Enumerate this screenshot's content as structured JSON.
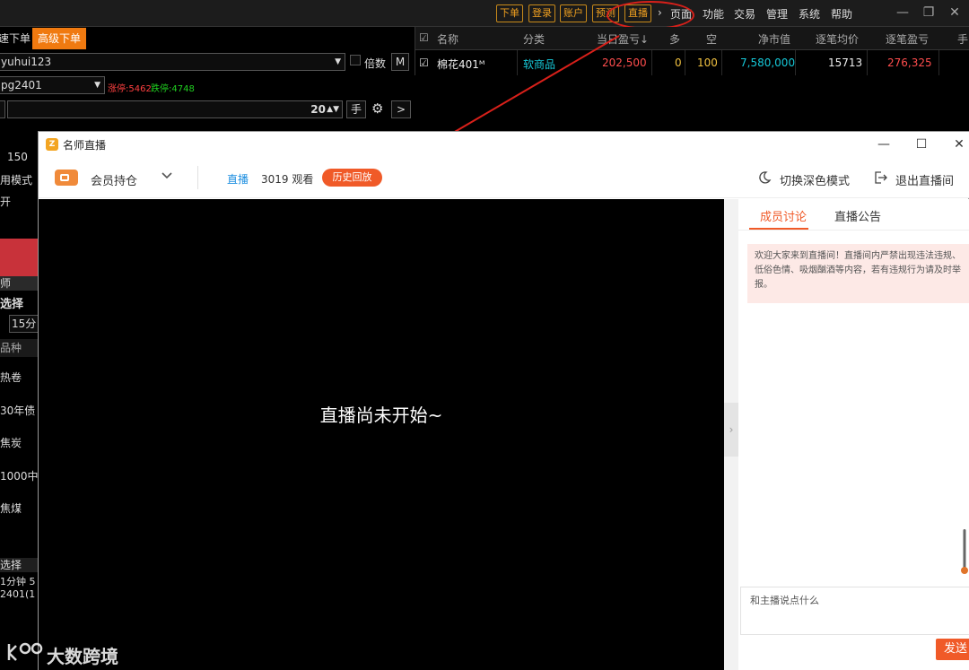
{
  "topbar": {
    "buttons": [
      "下单",
      "登录",
      "账户",
      "预测",
      "直播"
    ],
    "menu": [
      "页面",
      "功能",
      "交易",
      "管理",
      "系统",
      "帮助"
    ]
  },
  "left_panel": {
    "tabs": [
      "速下单",
      "高级下单"
    ],
    "account": "yuhui123",
    "multiplier_label": "倍数",
    "m_button": "M",
    "contract": "pg2401",
    "limit_up": "涨停:5462",
    "limit_down": "跌停:4748",
    "quantity": "20",
    "unit_label": "手",
    "price_150": "150",
    "mode_label": "用模式",
    "open_label": "开",
    "teacher_label": "师",
    "select_label": "选择",
    "period": "15分",
    "variety_header": "品种",
    "varieties": [
      "热卷",
      "30年债",
      "焦炭",
      "1000中",
      "焦煤"
    ],
    "bottom_select": "选择",
    "bottom_period": "1分钟  5",
    "bottom_contract": "2401(1"
  },
  "table": {
    "headers": [
      "名称",
      "分类",
      "当日盈亏↓",
      "多",
      "空",
      "净市值",
      "逐笔均价",
      "逐笔盈亏",
      "手"
    ],
    "row": {
      "name": "棉花401ᴹ",
      "category": "软商品",
      "daily_pnl": "202,500",
      "long": "0",
      "short": "100",
      "net_value": "7,580,000",
      "avg_price": "15713",
      "trade_pnl": "276,325"
    }
  },
  "popup": {
    "title": "名师直播",
    "member_position": "会员持仓",
    "live_label": "直播",
    "viewers": "3019 观看",
    "history_button": "历史回放",
    "dark_mode": "切换深色模式",
    "exit_live": "退出直播间",
    "video_message": "直播尚未开始~",
    "tabs": [
      "成员讨论",
      "直播公告"
    ],
    "notice": "欢迎大家来到直播间！直播间内严禁出现违法违规、低俗色情、吸烟酗酒等内容，若有违规行为请及时举报。",
    "chat_placeholder": "和主播说点什么",
    "send_button": "发送"
  },
  "watermark": "大数跨境",
  "colors": {
    "accent_orange": "#f05a28",
    "annotation_red": "#d8201a",
    "pnl_red": "#ff4d4d",
    "cyan": "#16c8d8",
    "yellow": "#f0c040"
  }
}
